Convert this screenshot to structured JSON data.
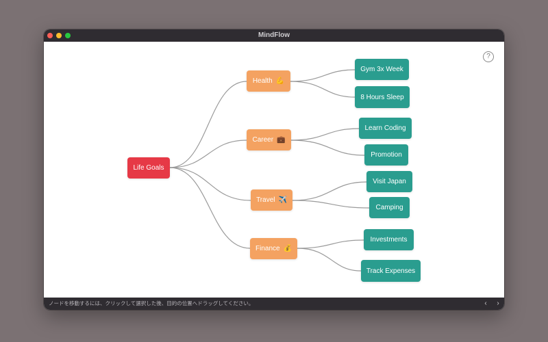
{
  "window": {
    "title": "MindFlow"
  },
  "mindmap": {
    "root": {
      "label": "Life Goals"
    },
    "branches": [
      {
        "label": "Health",
        "emoji": "💪",
        "children": [
          "Gym 3x Week",
          "8 Hours Sleep"
        ]
      },
      {
        "label": "Career",
        "emoji": "💼",
        "children": [
          "Learn Coding",
          "Promotion"
        ]
      },
      {
        "label": "Travel",
        "emoji": "✈️",
        "children": [
          "Visit Japan",
          "Camping"
        ]
      },
      {
        "label": "Finance",
        "emoji": "💰",
        "children": [
          "Investments",
          "Track Expenses"
        ]
      }
    ]
  },
  "help": {
    "label": "?"
  },
  "statusbar": {
    "hint": "ノードを移動するには、クリックして選択した後、目的の位置へドラッグしてください。",
    "prev": "‹",
    "next": "›"
  },
  "colors": {
    "root": "#e63946",
    "branch": "#f4a261",
    "leaf": "#2a9d8f",
    "link": "#9a9a9a"
  }
}
